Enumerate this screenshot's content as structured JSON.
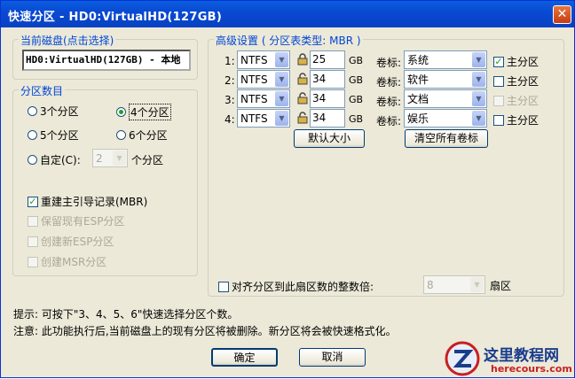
{
  "title": "快速分区 - HD0:VirtualHD(127GB)",
  "disk_group": {
    "label": "当前磁盘(点击选择)",
    "value": "HD0:VirtualHD(127GB) - 本地"
  },
  "count_group": {
    "label": "分区数目",
    "options": [
      "3个分区",
      "4个分区",
      "5个分区",
      "6个分区"
    ],
    "selected": "4个分区",
    "custom_label": "自定(C):",
    "custom_value": "2",
    "custom_suffix": "个分区"
  },
  "options": {
    "rebuild_mbr": "重建主引导记录(MBR)",
    "keep_esp": "保留现有ESP分区",
    "create_esp": "创建新ESP分区",
    "create_msr": "创建MSR分区"
  },
  "advanced": {
    "label": "高级设置 ( 分区表类型: MBR )",
    "rows": [
      {
        "num": "1:",
        "fs": "NTFS",
        "size": "25",
        "unit": "GB",
        "vol_label_text": "卷标:",
        "vol": "系统",
        "primary": "主分区",
        "primary_checked": true,
        "primary_disabled": false,
        "locked": true
      },
      {
        "num": "2:",
        "fs": "NTFS",
        "size": "34",
        "unit": "GB",
        "vol_label_text": "卷标:",
        "vol": "软件",
        "primary": "主分区",
        "primary_checked": false,
        "primary_disabled": false,
        "locked": false
      },
      {
        "num": "3:",
        "fs": "NTFS",
        "size": "34",
        "unit": "GB",
        "vol_label_text": "卷标:",
        "vol": "文档",
        "primary": "主分区",
        "primary_checked": false,
        "primary_disabled": true,
        "locked": false
      },
      {
        "num": "4:",
        "fs": "NTFS",
        "size": "34",
        "unit": "GB",
        "vol_label_text": "卷标:",
        "vol": "娱乐",
        "primary": "主分区",
        "primary_checked": false,
        "primary_disabled": false,
        "locked": false
      }
    ],
    "default_size_button": "默认大小",
    "clear_labels_button": "清空所有卷标",
    "align_label": "对齐分区到此扇区数的整数倍:",
    "align_value": "8",
    "align_unit": "扇区"
  },
  "hint1": "提示: 可按下\"3、4、5、6\"快速选择分区个数。",
  "hint2": "注意: 此功能执行后,当前磁盘上的现有分区将被删除。新分区将会被快速格式化。",
  "ok_button": "确定",
  "cancel_button": "取消",
  "watermark": {
    "text": "这里教程网",
    "url": "herecours.com"
  },
  "colors": {
    "title_bar": "#0a5fe0",
    "dialog_bg": "#ece9d8",
    "group_label": "#0046d5",
    "check": "#21a121"
  }
}
